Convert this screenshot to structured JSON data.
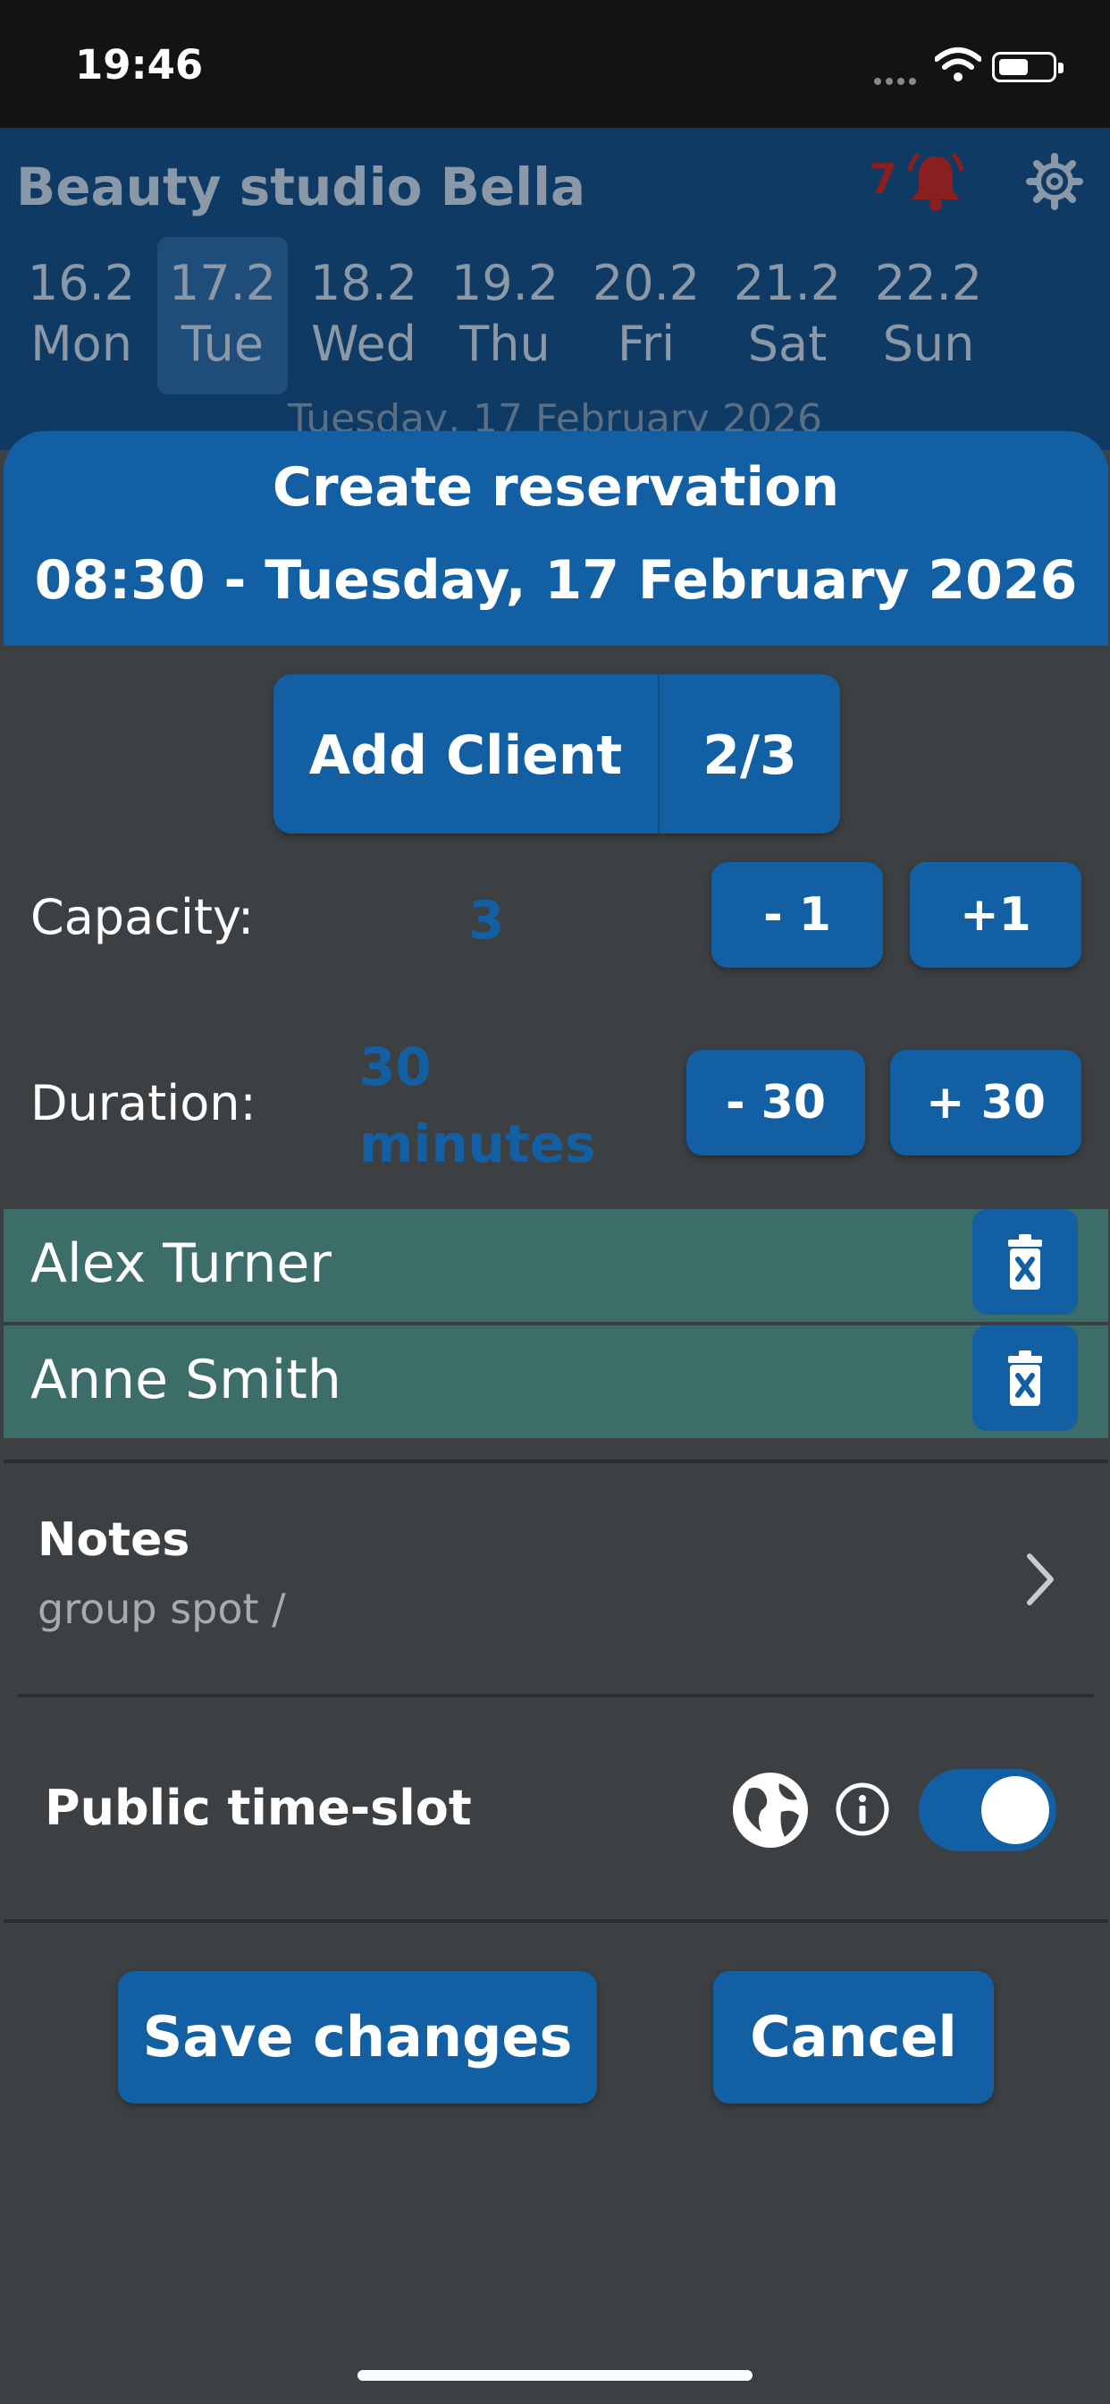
{
  "status_bar": {
    "time": "19:46"
  },
  "header": {
    "studio_name": "Beauty studio Bella",
    "alert_count": "7",
    "date_caption": "Tuesday, 17 February 2026",
    "days": [
      {
        "date": "16.2",
        "weekday": "Mon"
      },
      {
        "date": "17.2",
        "weekday": "Tue"
      },
      {
        "date": "18.2",
        "weekday": "Wed"
      },
      {
        "date": "19.2",
        "weekday": "Thu"
      },
      {
        "date": "20.2",
        "weekday": "Fri"
      },
      {
        "date": "21.2",
        "weekday": "Sat"
      },
      {
        "date": "22.2",
        "weekday": "Sun"
      }
    ]
  },
  "reservation": {
    "title": "Create reservation",
    "subtitle": "08:30 - Tuesday, 17 February 2026",
    "add_client_label": "Add Client",
    "client_count": "2/3",
    "capacity": {
      "label": "Capacity:",
      "value": "3",
      "minus": "- 1",
      "plus": "+1"
    },
    "duration": {
      "label": "Duration:",
      "value_line1": "30",
      "value_line2": "minutes",
      "minus": "- 30",
      "plus": "+ 30"
    },
    "clients": [
      {
        "name": "Alex Turner"
      },
      {
        "name": "Anne Smith"
      }
    ],
    "notes": {
      "title": "Notes",
      "text": "group spot /"
    },
    "public_slot": {
      "label": "Public time-slot",
      "enabled": true
    },
    "save_label": "Save changes",
    "cancel_label": "Cancel"
  },
  "colors": {
    "accent": "#1260a3",
    "header_bg": "#0f3a63",
    "sheet_bg": "#3d4043",
    "client_row": "#3d6d69",
    "alert": "#8a1f1f"
  }
}
